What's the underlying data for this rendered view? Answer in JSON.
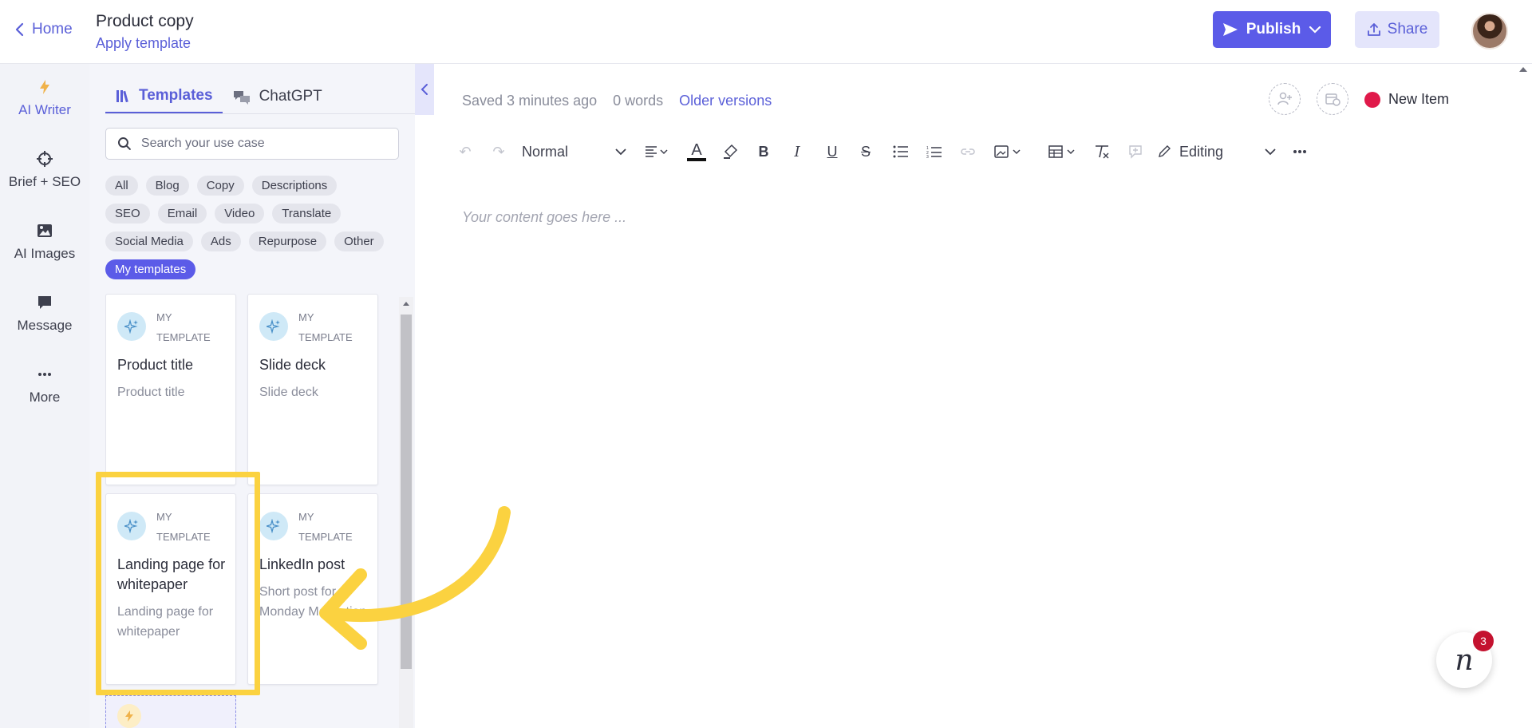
{
  "header": {
    "home_label": "Home",
    "doc_title": "Product copy",
    "apply_template": "Apply template",
    "publish_label": "Publish",
    "share_label": "Share"
  },
  "rail": {
    "items": [
      {
        "label": "AI Writer",
        "icon": "lightning-icon"
      },
      {
        "label": "Brief + SEO",
        "icon": "target-icon"
      },
      {
        "label": "AI Images",
        "icon": "image-icon"
      },
      {
        "label": "Message",
        "icon": "message-icon"
      },
      {
        "label": "More",
        "icon": "more-icon"
      }
    ]
  },
  "panel": {
    "tabs": [
      {
        "label": "Templates",
        "active": true
      },
      {
        "label": "ChatGPT",
        "active": false
      }
    ],
    "search_placeholder": "Search your use case",
    "chips": [
      [
        "All",
        "Blog",
        "Copy",
        "Descriptions"
      ],
      [
        "SEO",
        "Email",
        "Video",
        "Translate"
      ],
      [
        "Social Media",
        "Ads",
        "Repurpose",
        "Other"
      ],
      [
        "My templates"
      ]
    ],
    "active_chip": "My templates",
    "cards": [
      {
        "kind_line1": "MY",
        "kind_line2": "TEMPLATE",
        "title": "Product title",
        "desc": "Product title"
      },
      {
        "kind_line1": "MY",
        "kind_line2": "TEMPLATE",
        "title": "Slide deck",
        "desc": "Slide deck"
      },
      {
        "kind_line1": "MY",
        "kind_line2": "TEMPLATE",
        "title": "Landing page for whitepaper",
        "desc": "Landing page for whitepaper"
      },
      {
        "kind_line1": "MY",
        "kind_line2": "TEMPLATE",
        "title": "LinkedIn post",
        "desc": "Short post for Monday Motivation"
      }
    ]
  },
  "editor": {
    "saved_text": "Saved 3 minutes ago",
    "word_count": "0 words",
    "older_versions": "Older versions",
    "status_label": "New Item",
    "status_color": "#e0194a",
    "style_select": "Normal",
    "mode_select": "Editing",
    "placeholder": "Your content goes here ..."
  },
  "chat": {
    "unread_count": "3",
    "logo_letter": "n"
  },
  "colors": {
    "accent": "#5b5be8",
    "highlight": "#fbd240"
  }
}
